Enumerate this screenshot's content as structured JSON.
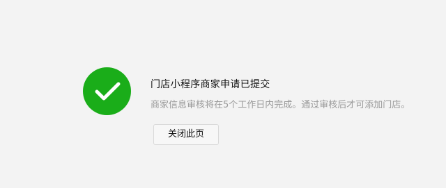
{
  "result": {
    "status": "success",
    "icon": "check-circle-icon",
    "accent_color": "#1aad19",
    "title": "门店小程序商家申请已提交",
    "description": "商家信息审核将在5个工作日内完成。通过审核后才可添加门店。",
    "close_label": "关闭此页"
  }
}
